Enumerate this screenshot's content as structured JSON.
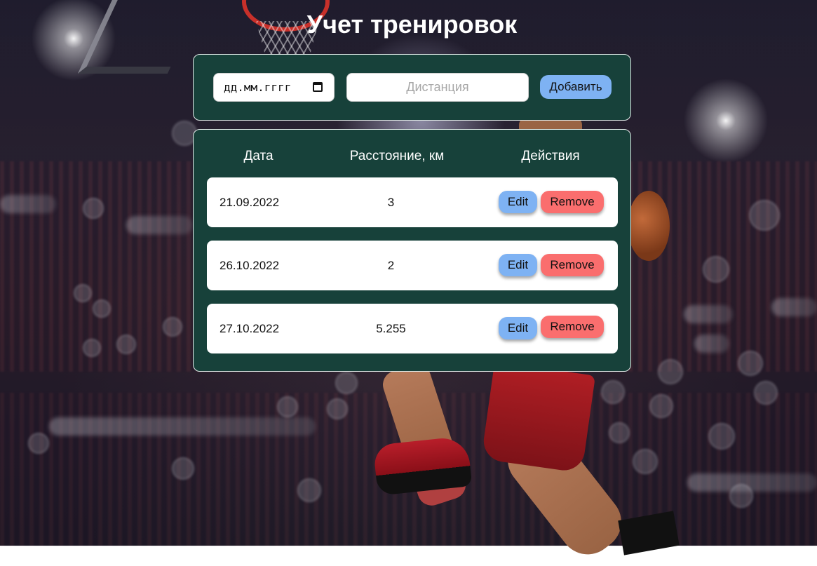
{
  "page": {
    "title": "Учет тренировок"
  },
  "form": {
    "date_value": "дд.мм.гггг",
    "distance_placeholder": "Дистанция",
    "add_label": "Добавить"
  },
  "table": {
    "headers": {
      "date": "Дата",
      "distance": "Расстояние, км",
      "actions": "Действия"
    },
    "rows": [
      {
        "date": "21.09.2022",
        "distance": "3",
        "edit": "Edit",
        "remove": "Remove"
      },
      {
        "date": "26.10.2022",
        "distance": "2",
        "edit": "Edit",
        "remove": "Remove"
      },
      {
        "date": "27.10.2022",
        "distance": "5.255",
        "edit": "Edit",
        "remove": "Remove"
      }
    ]
  },
  "colors": {
    "panel": "#17413a",
    "edit_button": "#7eb2f3",
    "remove_button": "#fa6e6e",
    "add_button": "#7eb2f3"
  },
  "icons": {
    "date_picker": "calendar-icon"
  }
}
